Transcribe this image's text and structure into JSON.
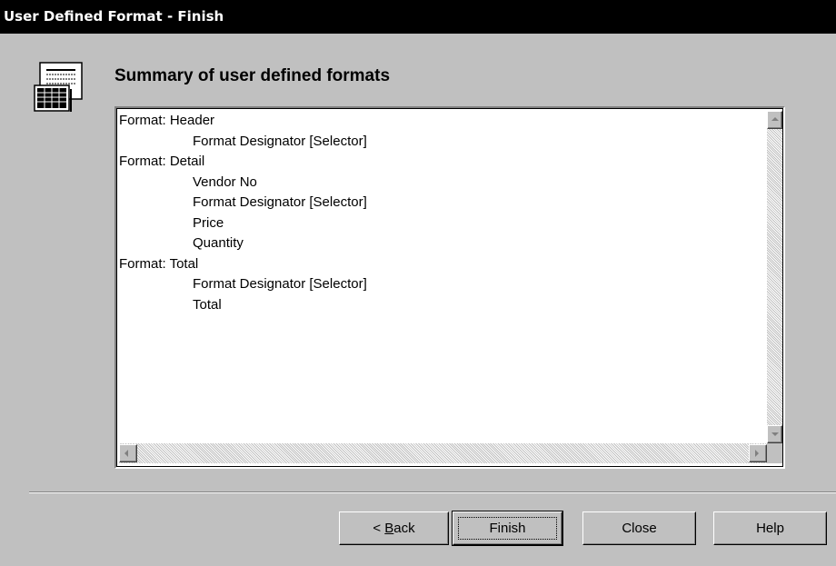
{
  "window": {
    "title": "User Defined Format - Finish"
  },
  "header": {
    "icon": "document-table-icon",
    "heading": "Summary of user defined formats"
  },
  "summary_list": {
    "lines": [
      {
        "text": "Format: Header",
        "indent": false
      },
      {
        "text": "Format Designator [Selector]",
        "indent": true
      },
      {
        "text": "Format: Detail",
        "indent": false
      },
      {
        "text": "Vendor No",
        "indent": true
      },
      {
        "text": "Format Designator [Selector]",
        "indent": true
      },
      {
        "text": "Price",
        "indent": true
      },
      {
        "text": "Quantity",
        "indent": true
      },
      {
        "text": "Format: Total",
        "indent": false
      },
      {
        "text": "Format Designator [Selector]",
        "indent": true
      },
      {
        "text": "Total",
        "indent": true
      }
    ]
  },
  "buttons": {
    "back_prefix": "< ",
    "back_mnemonic": "B",
    "back_rest": "ack",
    "finish": "Finish",
    "close": "Close",
    "help": "Help"
  },
  "colors": {
    "dialog_bg": "#c0c0c0",
    "titlebar_bg": "#000000",
    "titlebar_text": "#ffffff",
    "list_bg": "#ffffff"
  }
}
